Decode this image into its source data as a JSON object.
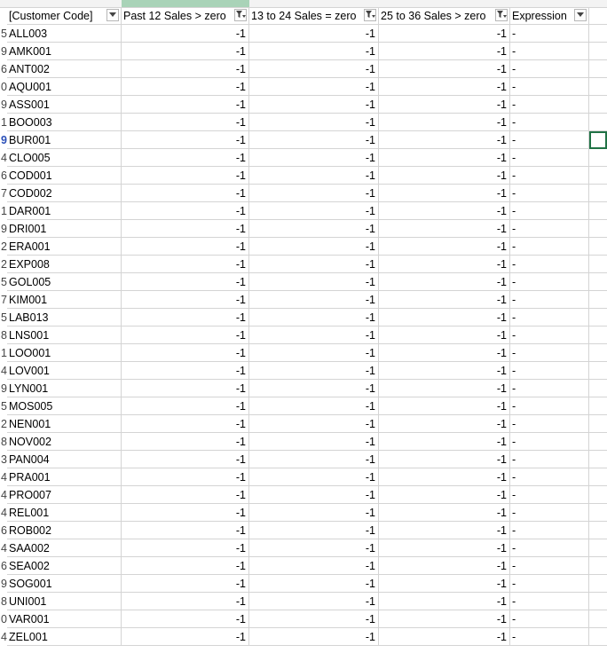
{
  "header": {
    "columns": [
      {
        "label": "[Customer Code]",
        "filter_icon": "dropdown-arrow-icon"
      },
      {
        "label": "Past 12 Sales > zero",
        "filter_icon": "filter-active-icon"
      },
      {
        "label": "13 to 24 Sales = zero",
        "filter_icon": "filter-active-icon"
      },
      {
        "label": "25 to 36 Sales > zero",
        "filter_icon": "filter-active-icon"
      },
      {
        "label": "Expression",
        "filter_icon": "dropdown-arrow-icon"
      }
    ]
  },
  "rows": [
    {
      "num": "5",
      "code": "ALL003",
      "v1": "-1",
      "v2": "-1",
      "v3": "-1",
      "expr": "-"
    },
    {
      "num": "9",
      "code": "AMK001",
      "v1": "-1",
      "v2": "-1",
      "v3": "-1",
      "expr": "-"
    },
    {
      "num": "6",
      "code": "ANT002",
      "v1": "-1",
      "v2": "-1",
      "v3": "-1",
      "expr": "-"
    },
    {
      "num": "0",
      "code": "AQU001",
      "v1": "-1",
      "v2": "-1",
      "v3": "-1",
      "expr": "-"
    },
    {
      "num": "9",
      "code": "ASS001",
      "v1": "-1",
      "v2": "-1",
      "v3": "-1",
      "expr": "-"
    },
    {
      "num": "1",
      "code": "BOO003",
      "v1": "-1",
      "v2": "-1",
      "v3": "-1",
      "expr": "-"
    },
    {
      "num": "9",
      "code": "BUR001",
      "v1": "-1",
      "v2": "-1",
      "v3": "-1",
      "expr": "-"
    },
    {
      "num": "4",
      "code": "CLO005",
      "v1": "-1",
      "v2": "-1",
      "v3": "-1",
      "expr": "-"
    },
    {
      "num": "6",
      "code": "COD001",
      "v1": "-1",
      "v2": "-1",
      "v3": "-1",
      "expr": "-"
    },
    {
      "num": "7",
      "code": "COD002",
      "v1": "-1",
      "v2": "-1",
      "v3": "-1",
      "expr": "-"
    },
    {
      "num": "1",
      "code": "DAR001",
      "v1": "-1",
      "v2": "-1",
      "v3": "-1",
      "expr": "-"
    },
    {
      "num": "9",
      "code": "DRI001",
      "v1": "-1",
      "v2": "-1",
      "v3": "-1",
      "expr": "-"
    },
    {
      "num": "2",
      "code": "ERA001",
      "v1": "-1",
      "v2": "-1",
      "v3": "-1",
      "expr": "-"
    },
    {
      "num": "2",
      "code": "EXP008",
      "v1": "-1",
      "v2": "-1",
      "v3": "-1",
      "expr": "-"
    },
    {
      "num": "5",
      "code": "GOL005",
      "v1": "-1",
      "v2": "-1",
      "v3": "-1",
      "expr": "-"
    },
    {
      "num": "7",
      "code": "KIM001",
      "v1": "-1",
      "v2": "-1",
      "v3": "-1",
      "expr": "-"
    },
    {
      "num": "5",
      "code": "LAB013",
      "v1": "-1",
      "v2": "-1",
      "v3": "-1",
      "expr": "-"
    },
    {
      "num": "8",
      "code": "LNS001",
      "v1": "-1",
      "v2": "-1",
      "v3": "-1",
      "expr": "-"
    },
    {
      "num": "1",
      "code": "LOO001",
      "v1": "-1",
      "v2": "-1",
      "v3": "-1",
      "expr": "-"
    },
    {
      "num": "4",
      "code": "LOV001",
      "v1": "-1",
      "v2": "-1",
      "v3": "-1",
      "expr": "-"
    },
    {
      "num": "9",
      "code": "LYN001",
      "v1": "-1",
      "v2": "-1",
      "v3": "-1",
      "expr": "-"
    },
    {
      "num": "5",
      "code": "MOS005",
      "v1": "-1",
      "v2": "-1",
      "v3": "-1",
      "expr": "-"
    },
    {
      "num": "2",
      "code": "NEN001",
      "v1": "-1",
      "v2": "-1",
      "v3": "-1",
      "expr": "-"
    },
    {
      "num": "8",
      "code": "NOV002",
      "v1": "-1",
      "v2": "-1",
      "v3": "-1",
      "expr": "-"
    },
    {
      "num": "3",
      "code": "PAN004",
      "v1": "-1",
      "v2": "-1",
      "v3": "-1",
      "expr": "-"
    },
    {
      "num": "4",
      "code": "PRA001",
      "v1": "-1",
      "v2": "-1",
      "v3": "-1",
      "expr": "-"
    },
    {
      "num": "4",
      "code": "PRO007",
      "v1": "-1",
      "v2": "-1",
      "v3": "-1",
      "expr": "-"
    },
    {
      "num": "4",
      "code": "REL001",
      "v1": "-1",
      "v2": "-1",
      "v3": "-1",
      "expr": "-"
    },
    {
      "num": "6",
      "code": "ROB002",
      "v1": "-1",
      "v2": "-1",
      "v3": "-1",
      "expr": "-"
    },
    {
      "num": "4",
      "code": "SAA002",
      "v1": "-1",
      "v2": "-1",
      "v3": "-1",
      "expr": "-"
    },
    {
      "num": "6",
      "code": "SEA002",
      "v1": "-1",
      "v2": "-1",
      "v3": "-1",
      "expr": "-"
    },
    {
      "num": "9",
      "code": "SOG001",
      "v1": "-1",
      "v2": "-1",
      "v3": "-1",
      "expr": "-"
    },
    {
      "num": "8",
      "code": "UNI001",
      "v1": "-1",
      "v2": "-1",
      "v3": "-1",
      "expr": "-"
    },
    {
      "num": "0",
      "code": "VAR001",
      "v1": "-1",
      "v2": "-1",
      "v3": "-1",
      "expr": "-"
    },
    {
      "num": "4",
      "code": "ZEL001",
      "v1": "-1",
      "v2": "-1",
      "v3": "-1",
      "expr": "-"
    }
  ],
  "active_row_index": 6,
  "colors": {
    "gridline": "#d4d4d4",
    "selected_col_header": "#a9d3b8",
    "selection_border": "#217346",
    "active_row_number": "#2a4fb8"
  }
}
